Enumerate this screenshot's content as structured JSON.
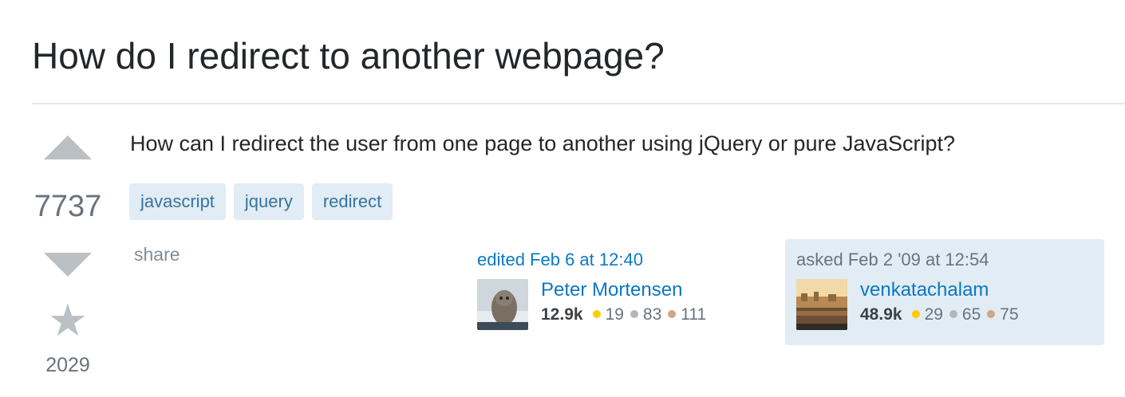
{
  "question": {
    "title": "How do I redirect to another webpage?",
    "body": "How can I redirect the user from one page to another using jQuery or pure JavaScript?",
    "votes": "7737",
    "favorites": "2029",
    "tags": [
      "javascript",
      "jquery",
      "redirect"
    ],
    "share_label": "share"
  },
  "editor": {
    "action": "edited Feb 6 at 12:40",
    "name": "Peter Mortensen",
    "reputation": "12.9k",
    "gold": "19",
    "silver": "83",
    "bronze": "111"
  },
  "asker": {
    "action": "asked Feb 2 '09 at 12:54",
    "name": "venkatachalam",
    "reputation": "48.9k",
    "gold": "29",
    "silver": "65",
    "bronze": "75"
  },
  "colors": {
    "link": "#0c77bf",
    "tag_bg": "#e1ecf4",
    "tag_text": "#39739d",
    "gold": "#ffcc01",
    "silver": "#b4b8bc",
    "bronze": "#d1a684",
    "vote_arrow": "#bbc0c4"
  },
  "icons": {
    "upvote": "triangle-up",
    "downvote": "triangle-down",
    "favorite": "star"
  }
}
